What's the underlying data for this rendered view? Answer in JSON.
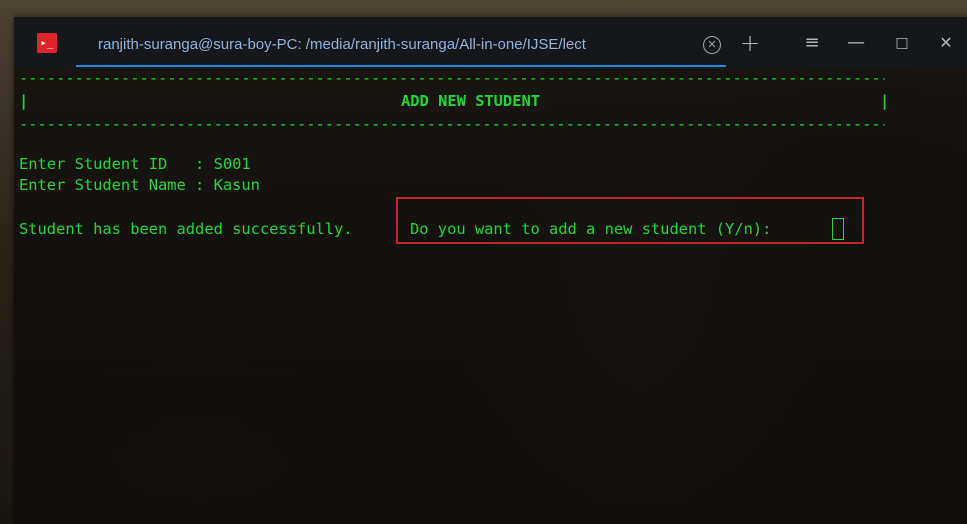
{
  "window": {
    "app_icon_glyph": "▸_",
    "tab_title": "ranjith-suranga@sura-boy-PC: /media/ranjith-suranga/All-in-one/IJSE/lect",
    "tab_close_icon": "close-icon",
    "controls": {
      "new_tab": "+",
      "menu": "≡",
      "minimize": "—",
      "maximize": "□",
      "close": "✕"
    }
  },
  "terminal": {
    "border_line": "----------------------------------------------------------------------------------------------------------------------------------------------",
    "header_left": "|",
    "header_title": "ADD NEW STUDENT",
    "header_right": "|",
    "id_line": "Enter Student ID   : S001",
    "name_line": "Enter Student Name : Kasun",
    "success_text": "Student has been added successfully.",
    "prompt_text": "Do you want to add a new student (Y/n):",
    "text_color": "#21d635"
  },
  "highlight_color": "#c8242a"
}
